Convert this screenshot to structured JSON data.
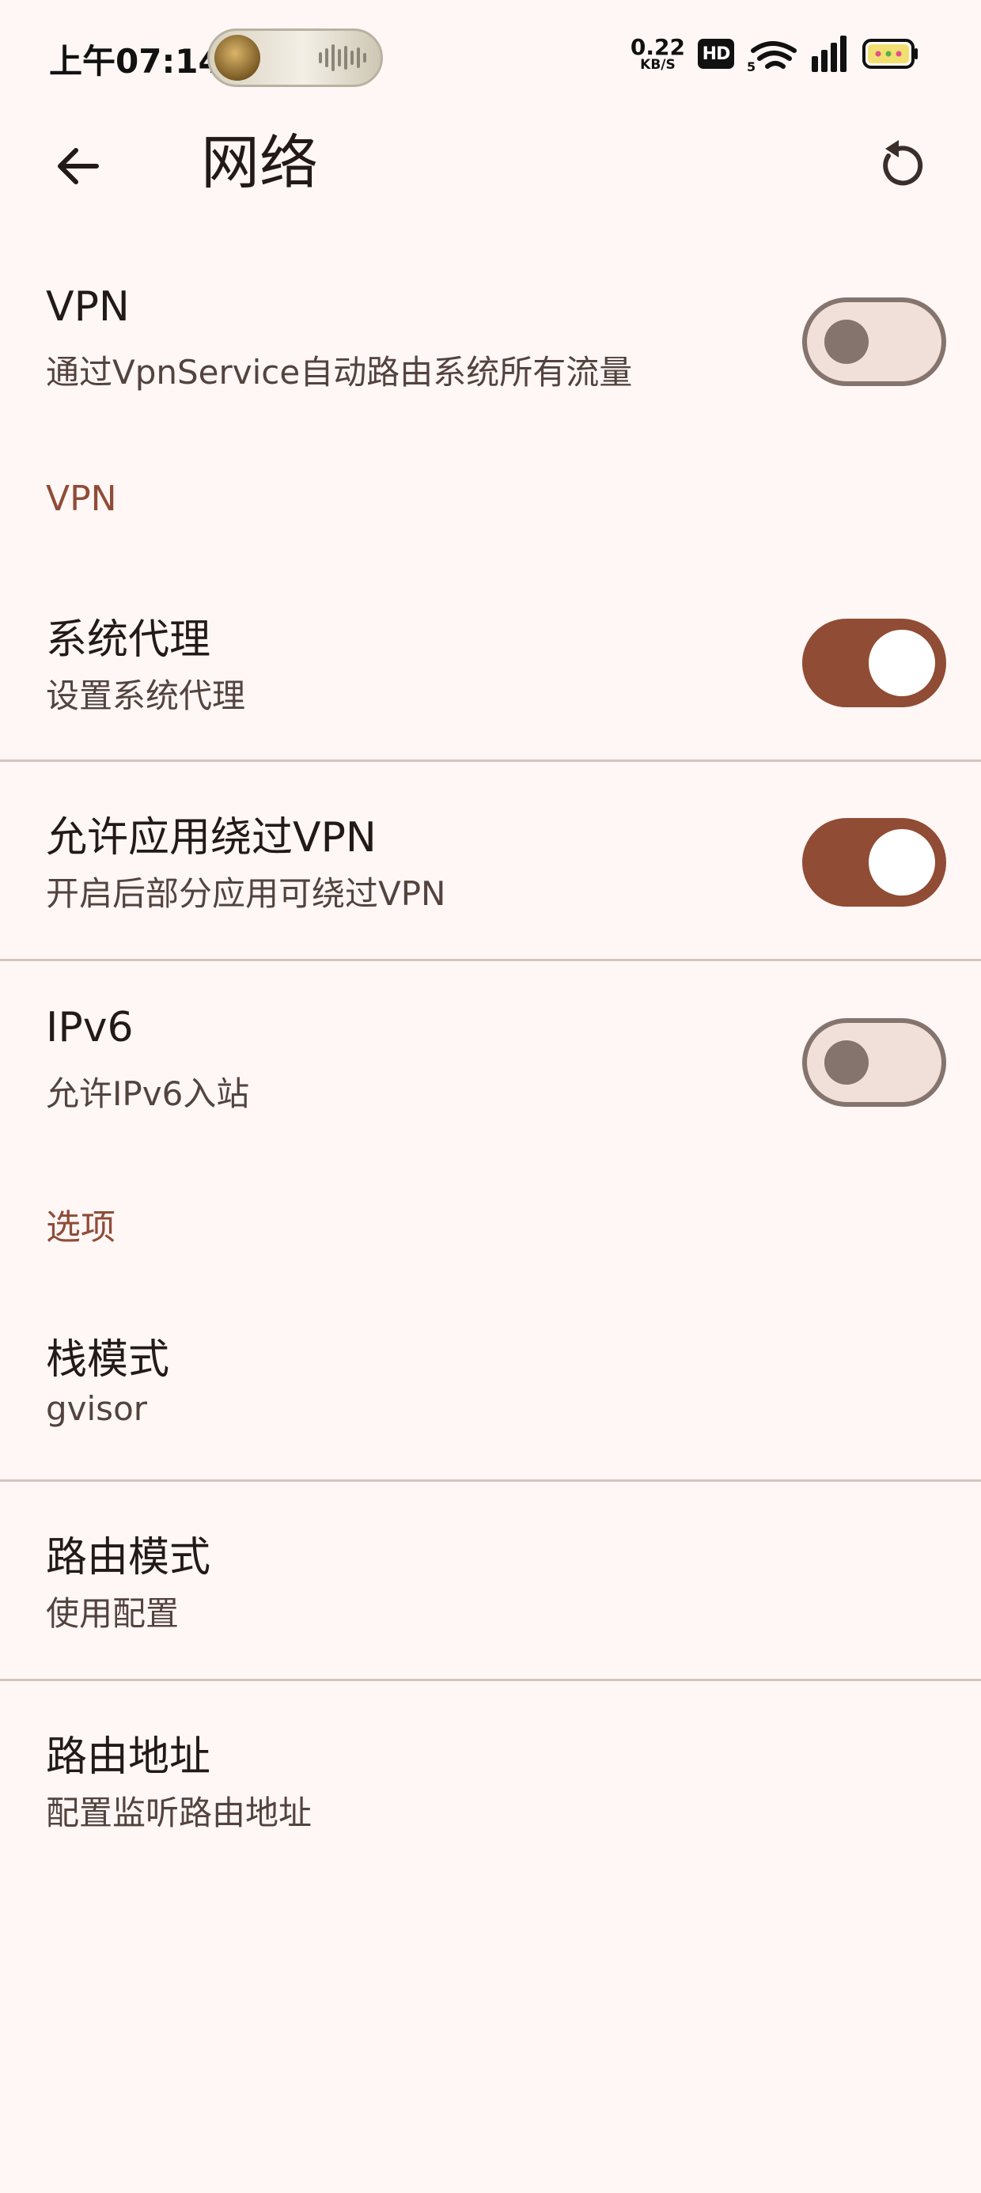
{
  "status_bar": {
    "time": "上午07:14",
    "net_speed_value": "0.22",
    "net_speed_unit": "KB/S",
    "hd_label": "HD",
    "signal_label": "5"
  },
  "app_bar": {
    "back_icon": "arrow-left-icon",
    "title": "网络",
    "reset_icon": "refresh-icon"
  },
  "settings": {
    "vpn": {
      "title": "VPN",
      "subtitle": "通过VpnService自动路由系统所有流量",
      "enabled": false
    },
    "section_vpn": "VPN",
    "system_proxy": {
      "title": "系统代理",
      "subtitle": "设置系统代理",
      "enabled": true
    },
    "bypass_vpn": {
      "title": "允许应用绕过VPN",
      "subtitle": "开启后部分应用可绕过VPN",
      "enabled": true
    },
    "ipv6": {
      "title": "IPv6",
      "subtitle": "允许IPv6入站",
      "enabled": false
    },
    "section_options": "选项",
    "stack_mode": {
      "title": "栈模式",
      "value": "gvisor"
    },
    "route_mode": {
      "title": "路由模式",
      "value": "使用配置"
    },
    "route_address": {
      "title": "路由地址",
      "subtitle": "配置监听路由地址"
    }
  },
  "colors": {
    "background": "#fff7f5",
    "accent": "#904c34",
    "section_header": "#8f4c38",
    "switch_off_outline": "#85736e",
    "switch_off_track": "#f1dfda"
  }
}
